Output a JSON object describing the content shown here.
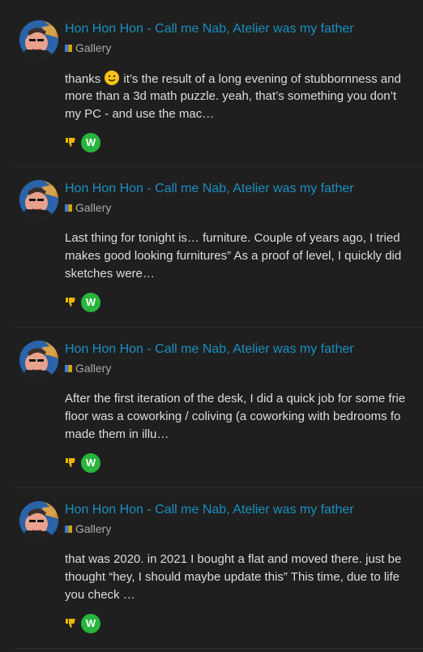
{
  "posts": [
    {
      "author": "Hon Hon Hon - Call me Nab, Atelier was my father",
      "category": "Gallery",
      "excerpt_lines": [
        "it’s the result of a long evening of stubbornness and",
        "more than a 3d math puzzle. yeah, that’s something you don’t",
        "my PC - and use the mac…"
      ],
      "excerpt_prefix": "thanks",
      "reaction_user": "W"
    },
    {
      "author": "Hon Hon Hon - Call me Nab, Atelier was my father",
      "category": "Gallery",
      "excerpt_lines": [
        "Last thing for tonight is… furniture. Couple of years ago, I tried",
        "makes good looking furnitures” As a proof of level, I quickly did",
        "sketches were…"
      ],
      "reaction_user": "W"
    },
    {
      "author": "Hon Hon Hon - Call me Nab, Atelier was my father",
      "category": "Gallery",
      "excerpt_lines": [
        "After the first iteration of the desk, I did a quick job for some frie",
        "floor was a coworking / coliving (a coworking with bedrooms fo",
        "made them in illu…"
      ],
      "reaction_user": "W"
    },
    {
      "author": "Hon Hon Hon - Call me Nab, Atelier was my father",
      "category": "Gallery",
      "excerpt_lines": [
        "that was 2020. in 2021 I bought a flat and moved there. just be",
        "thought “hey, I should maybe update this” This time, due to life",
        "you check …"
      ],
      "reaction_user": "W"
    }
  ],
  "colors": {
    "background": "#1f1f1f",
    "author_link": "#1b8fc1",
    "text": "#dddddd",
    "muted": "#a9a9a9",
    "reaction_avatar": "#27b53d",
    "divider": "#2d2d2d"
  },
  "icons": {
    "dislike": "thumbs-down-icon",
    "smile": "smiling-face-emoji"
  }
}
